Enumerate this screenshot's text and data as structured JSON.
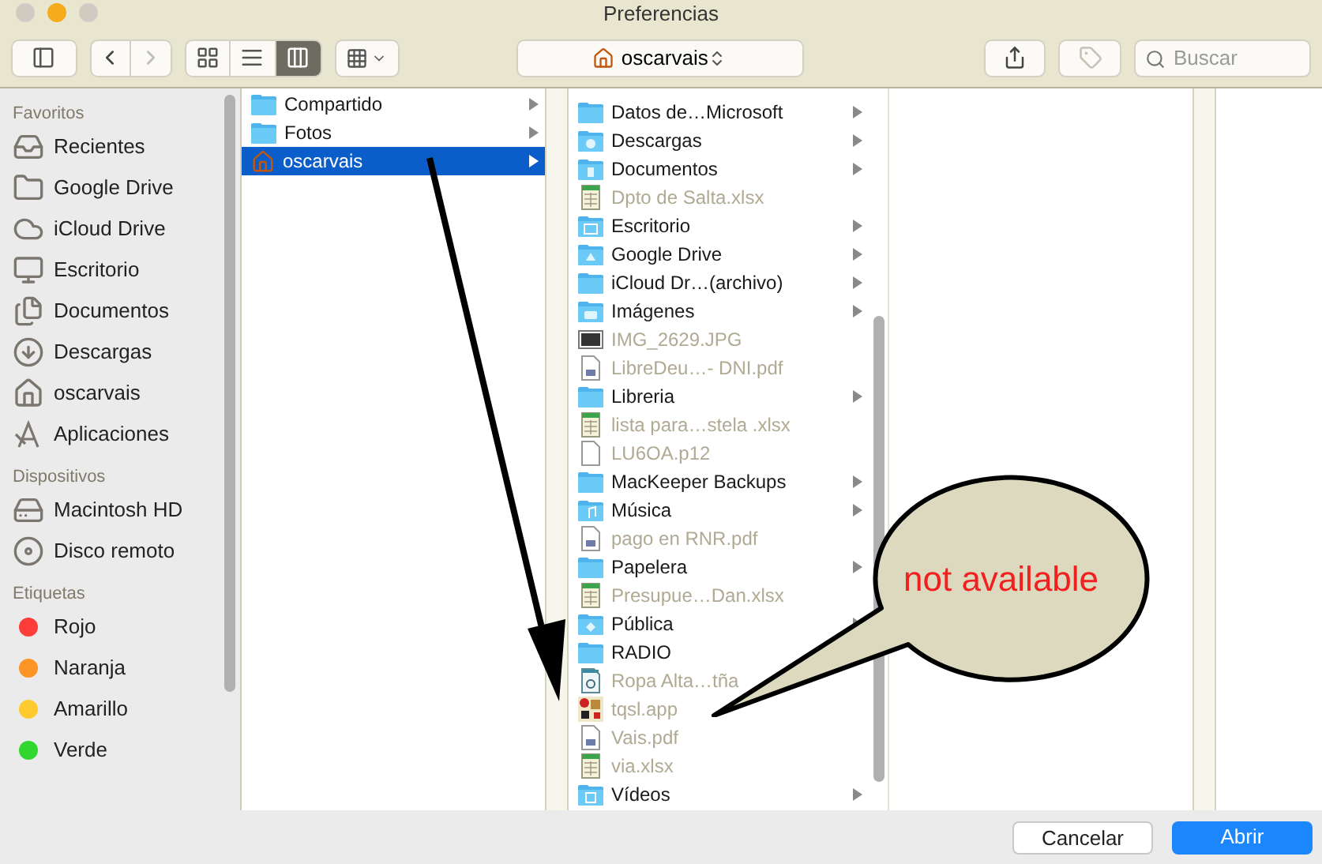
{
  "window": {
    "title": "Preferencias",
    "lights": [
      {
        "color": "#cfcbc0"
      },
      {
        "color": "#f5ab1b"
      },
      {
        "color": "#cfcbc0"
      }
    ]
  },
  "toolbar": {
    "views": [
      {
        "kind": "icons",
        "selected": false
      },
      {
        "kind": "list",
        "selected": false
      },
      {
        "kind": "columns",
        "selected": true
      }
    ],
    "path": "oscarvais",
    "search": {
      "placeholder": "Buscar"
    },
    "tag_disabled": true
  },
  "sidebar": {
    "sections": [
      {
        "title": "Favoritos",
        "items": [
          {
            "label": "Recientes",
            "kind": "recents"
          },
          {
            "label": "Google Drive",
            "kind": "folder"
          },
          {
            "label": "iCloud Drive",
            "kind": "cloud"
          },
          {
            "label": "Escritorio",
            "kind": "desktop"
          },
          {
            "label": "Documentos",
            "kind": "documents"
          },
          {
            "label": "Descargas",
            "kind": "download"
          },
          {
            "label": "oscarvais",
            "kind": "home"
          },
          {
            "label": "Aplicaciones",
            "kind": "apps"
          }
        ]
      },
      {
        "title": "Dispositivos",
        "items": [
          {
            "label": "Macintosh HD",
            "kind": "disk"
          },
          {
            "label": "Disco remoto",
            "kind": "disc"
          }
        ]
      },
      {
        "title": "Etiquetas",
        "items": [
          {
            "label": "Rojo",
            "kind": "tag",
            "color": "#fc3d39"
          },
          {
            "label": "Naranja",
            "kind": "tag",
            "color": "#fd9426"
          },
          {
            "label": "Amarillo",
            "kind": "tag",
            "color": "#fecb2f"
          },
          {
            "label": "Verde",
            "kind": "tag",
            "color": "#2fd72f"
          }
        ]
      }
    ]
  },
  "columns": [
    {
      "rows": [
        {
          "name": "Compartido",
          "kind": "folder",
          "has_children": true,
          "selected": false,
          "disabled": false
        },
        {
          "name": "Fotos",
          "kind": "folder",
          "has_children": true,
          "selected": false,
          "disabled": false
        },
        {
          "name": "oscarvais",
          "kind": "home",
          "has_children": true,
          "selected": true,
          "disabled": false
        }
      ]
    },
    {
      "rows": [
        {
          "name": "Datos de…Microsoft",
          "kind": "folder",
          "has_children": true,
          "selected": false,
          "disabled": false
        },
        {
          "name": "Descargas",
          "kind": "folder-download",
          "has_children": true,
          "selected": false,
          "disabled": false
        },
        {
          "name": "Documentos",
          "kind": "folder-doc",
          "has_children": true,
          "selected": false,
          "disabled": false
        },
        {
          "name": "Dpto de Salta.xlsx",
          "kind": "spreadsheet",
          "has_children": false,
          "selected": false,
          "disabled": true
        },
        {
          "name": "Escritorio",
          "kind": "folder-desktop",
          "has_children": true,
          "selected": false,
          "disabled": false
        },
        {
          "name": "Google Drive",
          "kind": "folder-drive",
          "has_children": true,
          "selected": false,
          "disabled": false
        },
        {
          "name": "iCloud Dr…(archivo)",
          "kind": "folder",
          "has_children": true,
          "selected": false,
          "disabled": false
        },
        {
          "name": "Imágenes",
          "kind": "folder-camera",
          "has_children": true,
          "selected": false,
          "disabled": false
        },
        {
          "name": "IMG_2629.JPG",
          "kind": "image",
          "has_children": false,
          "selected": false,
          "disabled": true
        },
        {
          "name": "LibreDeu…- DNI.pdf",
          "kind": "pdf",
          "has_children": false,
          "selected": false,
          "disabled": true
        },
        {
          "name": "Libreria",
          "kind": "folder",
          "has_children": true,
          "selected": false,
          "disabled": false
        },
        {
          "name": "lista para…stela .xlsx",
          "kind": "spreadsheet",
          "has_children": false,
          "selected": false,
          "disabled": true
        },
        {
          "name": "LU6OA.p12",
          "kind": "document",
          "has_children": false,
          "selected": false,
          "disabled": true
        },
        {
          "name": "MacKeeper Backups",
          "kind": "folder",
          "has_children": true,
          "selected": false,
          "disabled": false
        },
        {
          "name": "Música",
          "kind": "folder-music",
          "has_children": true,
          "selected": false,
          "disabled": false
        },
        {
          "name": "pago en RNR.pdf",
          "kind": "pdf",
          "has_children": false,
          "selected": false,
          "disabled": true
        },
        {
          "name": "Papelera",
          "kind": "folder",
          "has_children": true,
          "selected": false,
          "disabled": false
        },
        {
          "name": "Presupue…Dan.xlsx",
          "kind": "spreadsheet",
          "has_children": false,
          "selected": false,
          "disabled": true
        },
        {
          "name": "Pública",
          "kind": "folder-public",
          "has_children": true,
          "selected": false,
          "disabled": false
        },
        {
          "name": "RADIO",
          "kind": "folder",
          "selected": false,
          "disabled": false
        },
        {
          "name": "Ropa Alta…tña",
          "kind": "text",
          "has_children": false,
          "selected": false,
          "disabled": true
        },
        {
          "name": "tqsl.app",
          "kind": "app",
          "has_children": false,
          "selected": false,
          "disabled": true
        },
        {
          "name": "Vais.pdf",
          "kind": "pdf",
          "has_children": false,
          "selected": false,
          "disabled": true
        },
        {
          "name": "via.xlsx",
          "kind": "spreadsheet",
          "has_children": false,
          "selected": false,
          "disabled": true
        },
        {
          "name": "Vídeos",
          "kind": "folder-video",
          "has_children": true,
          "selected": false,
          "disabled": false
        }
      ]
    }
  ],
  "annotation": {
    "text": "not available"
  },
  "buttons": [
    {
      "label": "Cancelar",
      "kind": "secondary"
    },
    {
      "label": "Abrir",
      "kind": "primary"
    }
  ]
}
